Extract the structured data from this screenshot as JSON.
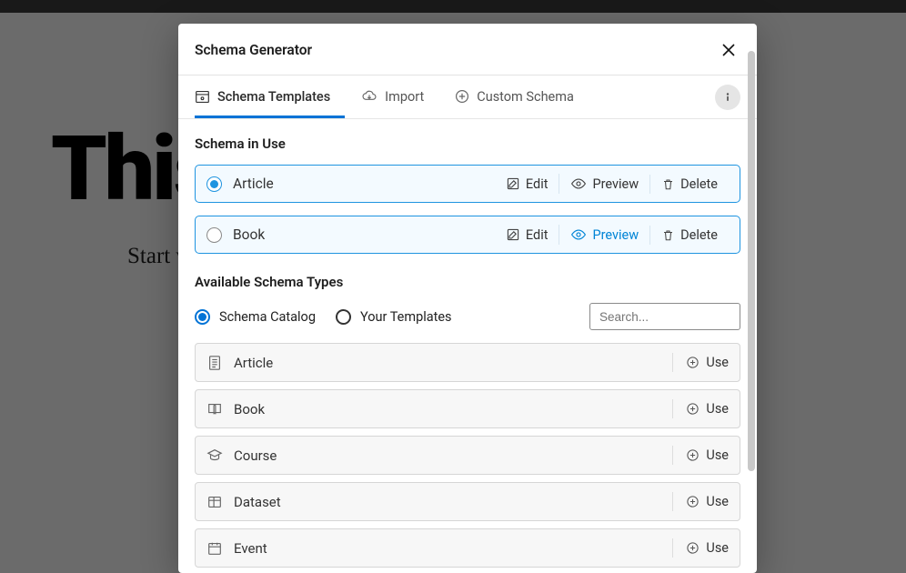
{
  "background": {
    "title": "This",
    "subtitle": "Start w"
  },
  "modal": {
    "title": "Schema Generator"
  },
  "tabs": {
    "templates": "Schema Templates",
    "import": "Import",
    "custom": "Custom Schema"
  },
  "sections": {
    "in_use": "Schema in Use",
    "available": "Available Schema Types"
  },
  "actions": {
    "edit": "Edit",
    "preview": "Preview",
    "delete": "Delete",
    "use": "Use"
  },
  "in_use_items": [
    {
      "name": "Article",
      "selected": true
    },
    {
      "name": "Book",
      "selected": false
    }
  ],
  "filter": {
    "catalog": "Schema Catalog",
    "your_templates": "Your Templates"
  },
  "search": {
    "placeholder": "Search..."
  },
  "available_items": [
    {
      "name": "Article"
    },
    {
      "name": "Book"
    },
    {
      "name": "Course"
    },
    {
      "name": "Dataset"
    },
    {
      "name": "Event"
    }
  ]
}
